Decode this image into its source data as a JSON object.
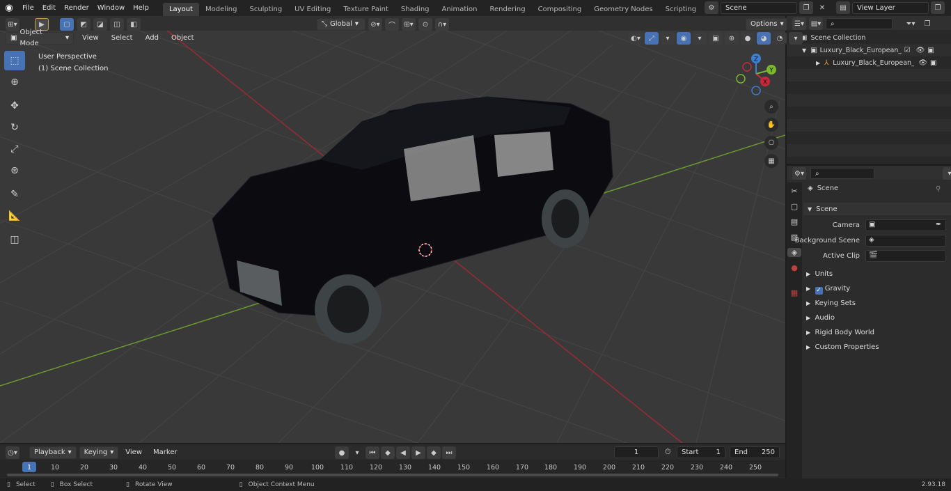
{
  "topbar": {
    "menus": [
      "File",
      "Edit",
      "Render",
      "Window",
      "Help"
    ],
    "workspaces": [
      "Layout",
      "Modeling",
      "Sculpting",
      "UV Editing",
      "Texture Paint",
      "Shading",
      "Animation",
      "Rendering",
      "Compositing",
      "Geometry Nodes",
      "Scripting"
    ],
    "active_workspace": "Layout",
    "add_tab": "+",
    "scene": "Scene",
    "view_layer": "View Layer"
  },
  "viewport_header": {
    "mode": "Object Mode",
    "menus": [
      "View",
      "Select",
      "Add",
      "Object"
    ],
    "orientation": "Global",
    "options": "Options"
  },
  "viewport": {
    "perspective": "User Perspective",
    "collection": "(1) Scene Collection",
    "gizmo_labels": {
      "x": "X",
      "y": "Y",
      "z": "Z"
    }
  },
  "outliner": {
    "root": "Scene Collection",
    "items": [
      {
        "label": "Luxury_Black_European_Cros"
      },
      {
        "label": "Luxury_Black_European_"
      }
    ]
  },
  "properties": {
    "context": "Scene",
    "panel": "Scene",
    "fields": [
      {
        "label": "Camera",
        "value": ""
      },
      {
        "label": "Background Scene",
        "value": ""
      },
      {
        "label": "Active Clip",
        "value": ""
      }
    ],
    "sections": [
      "Units",
      "Gravity",
      "Keying Sets",
      "Audio",
      "Rigid Body World",
      "Custom Properties"
    ]
  },
  "timeline": {
    "menus": [
      "Playback",
      "Keying",
      "View",
      "Marker"
    ],
    "current_frame": "1",
    "start_label": "Start",
    "start": "1",
    "end_label": "End",
    "end": "250",
    "ticks": [
      "1",
      "10",
      "20",
      "30",
      "40",
      "50",
      "60",
      "70",
      "80",
      "90",
      "100",
      "110",
      "120",
      "130",
      "140",
      "150",
      "160",
      "170",
      "180",
      "190",
      "200",
      "210",
      "220",
      "230",
      "240",
      "250"
    ]
  },
  "statusbar": {
    "items": [
      "Select",
      "Box Select",
      "Rotate View",
      "Object Context Menu"
    ],
    "version": "2.93.18"
  },
  "colors": {
    "accent": "#4772b3",
    "x_axis": "#c9283b",
    "y_axis": "#7ab82c",
    "z_axis": "#3b7fd1"
  }
}
